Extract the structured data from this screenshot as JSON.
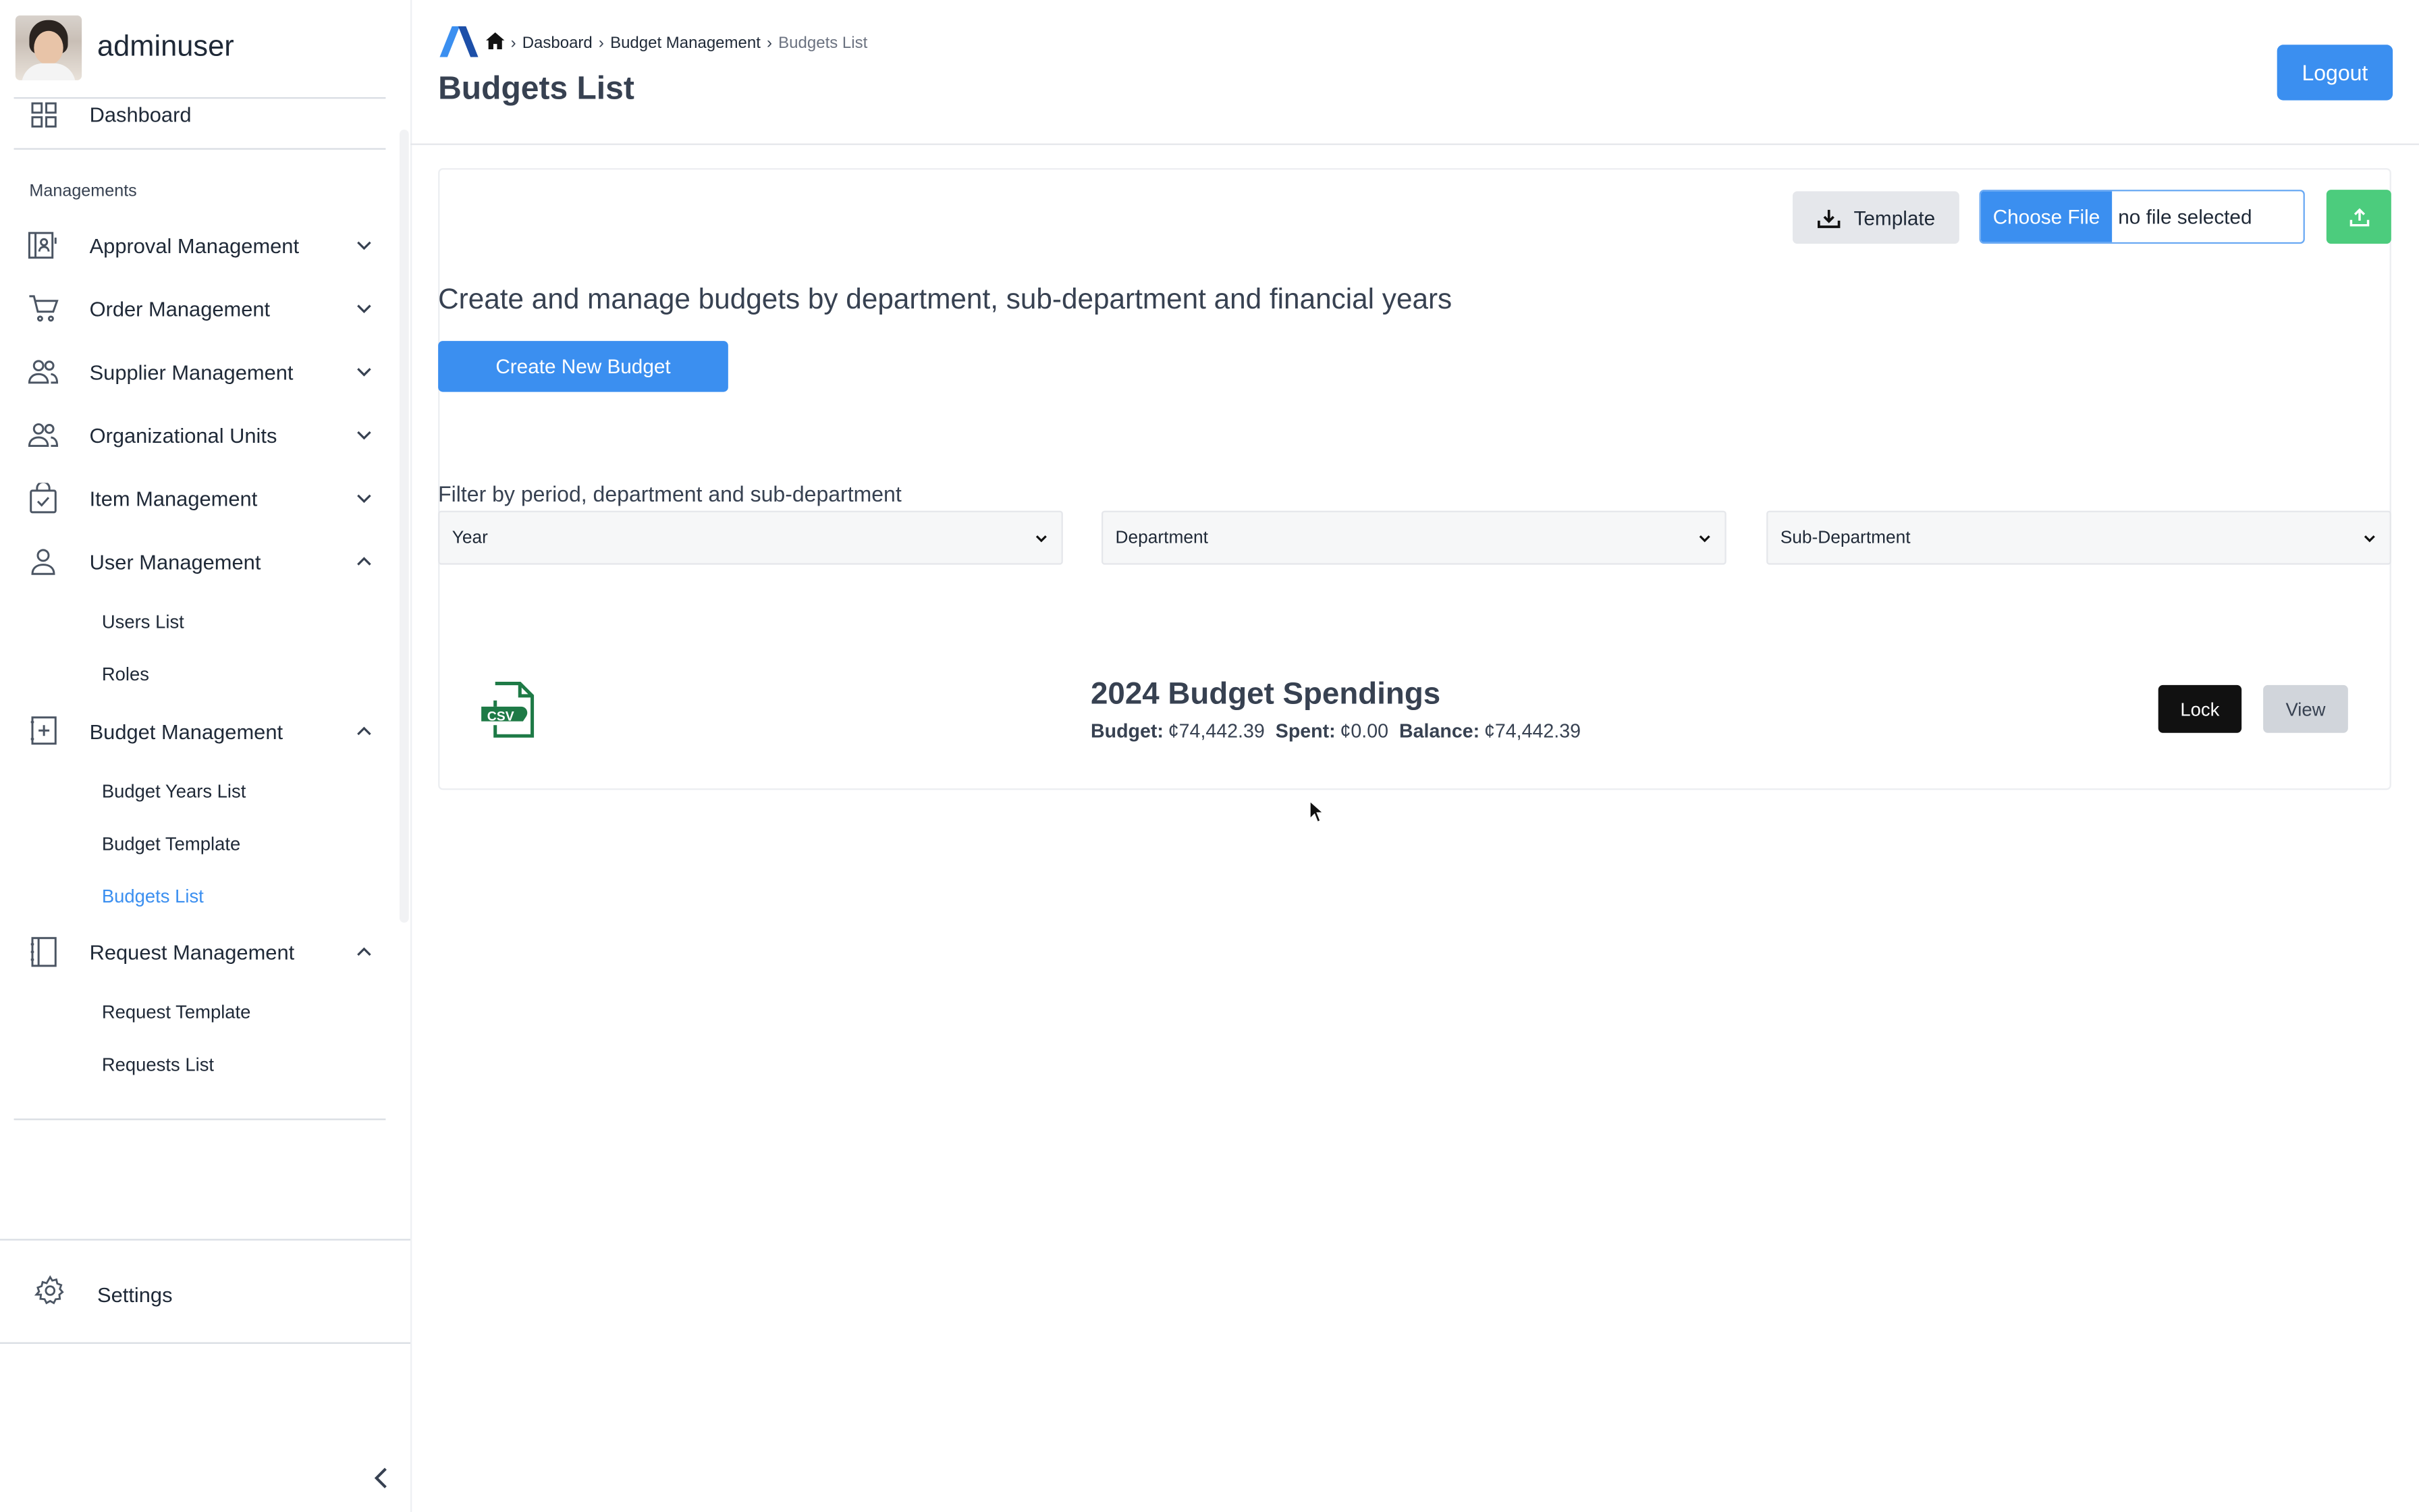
{
  "sidebar": {
    "username": "adminuser",
    "dashboard_label": "Dashboard",
    "section_label": "Managements",
    "items": [
      {
        "label": "Approval Management",
        "icon": "approval-icon"
      },
      {
        "label": "Order Management",
        "icon": "cart-icon"
      },
      {
        "label": "Supplier Management",
        "icon": "users-icon"
      },
      {
        "label": "Organizational Units",
        "icon": "users-icon"
      },
      {
        "label": "Item Management",
        "icon": "bag-check-icon"
      },
      {
        "label": "User Management",
        "icon": "user-icon"
      },
      {
        "label": "Budget Management",
        "icon": "budget-icon"
      },
      {
        "label": "Request Management",
        "icon": "notebook-icon"
      }
    ],
    "user_sub": [
      "Users List",
      "Roles"
    ],
    "budget_sub": [
      "Budget Years List",
      "Budget Template",
      "Budgets List"
    ],
    "request_sub": [
      "Request Template",
      "Requests List"
    ],
    "settings_label": "Settings",
    "active_color": "#3b8ff0"
  },
  "header": {
    "breadcrumb": [
      "Dasboard",
      "Budget Management",
      "Budgets List"
    ],
    "title": "Budgets List",
    "logout_label": "Logout"
  },
  "toolbar": {
    "template_label": "Template",
    "choose_file_label": "Choose File",
    "no_file_label": "no file selected"
  },
  "main": {
    "intro": "Create and manage budgets by department, sub-department and financial years",
    "create_label": "Create New Budget",
    "filter_label": "Filter by period, department and sub-department",
    "filters": {
      "year": "Year",
      "department": "Department",
      "sub_department": "Sub-Department"
    }
  },
  "budget_card": {
    "file_type": "CSV",
    "title": "2024 Budget Spendings",
    "budget_key": "Budget:",
    "budget_value": "¢74,442.39",
    "spent_key": "Spent:",
    "spent_value": "¢0.00",
    "balance_key": "Balance:",
    "balance_value": "¢74,442.39",
    "lock_label": "Lock",
    "view_label": "View"
  },
  "colors": {
    "primary": "#3b8ff0",
    "success": "#4ccc7d",
    "dark": "#111111",
    "csv_green": "#1e7a46"
  }
}
